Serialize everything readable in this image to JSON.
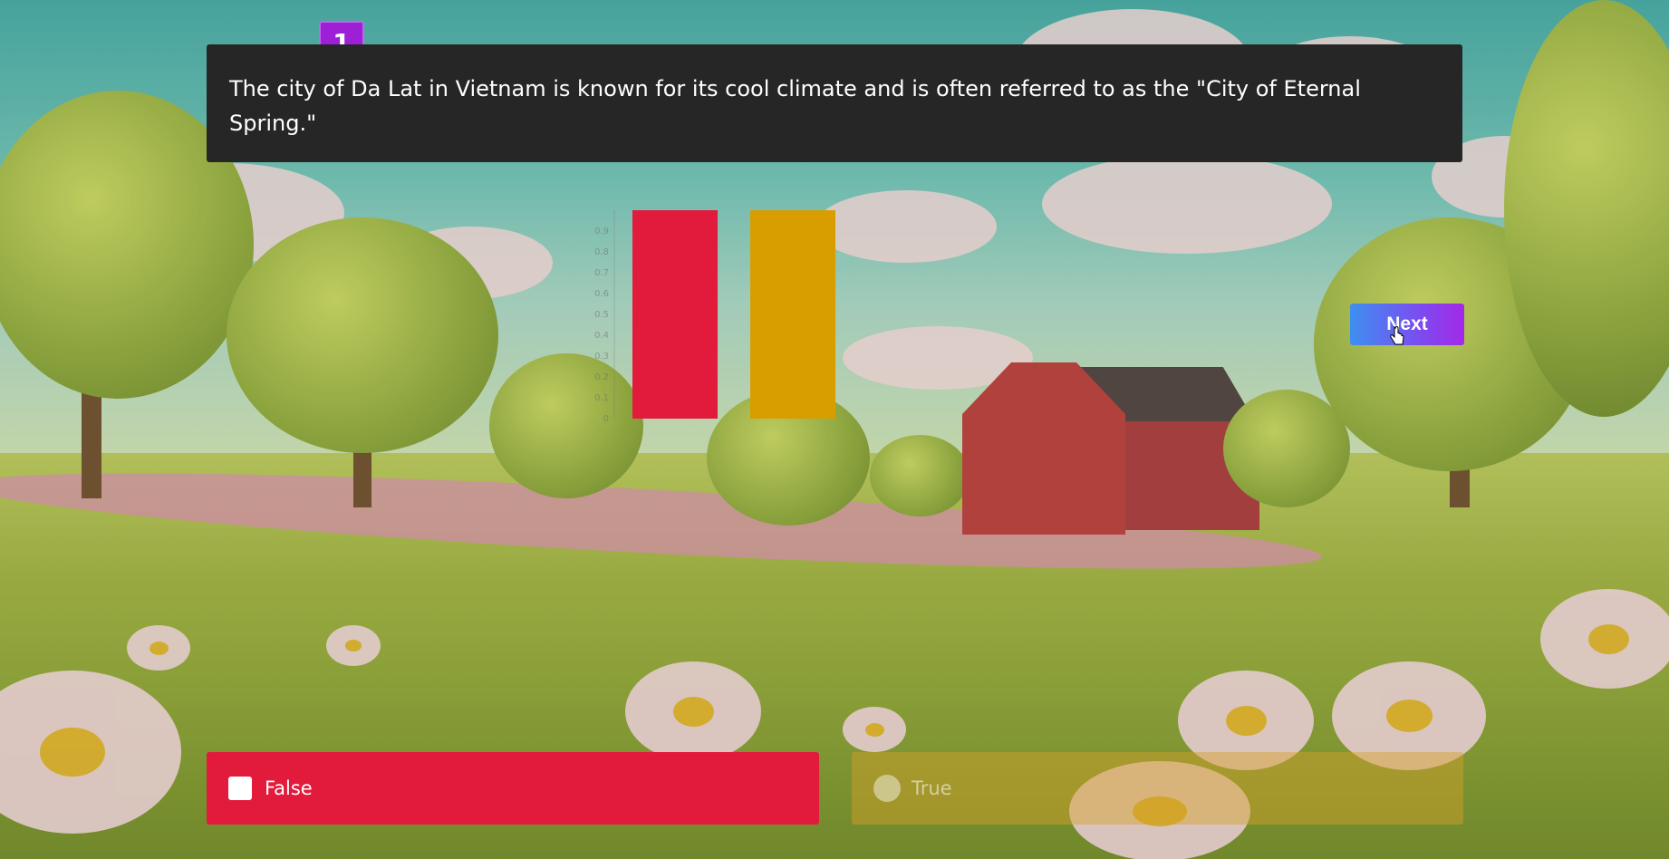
{
  "question": {
    "number": "1",
    "text": "The city of Da Lat in Vietnam is known for its cool climate and is often referred to as the \"City of Eternal Spring.\""
  },
  "chart_data": {
    "type": "bar",
    "categories": [
      "False",
      "True"
    ],
    "values": [
      1,
      1
    ],
    "ylim": [
      0,
      1
    ],
    "y_ticks": [
      "0",
      "0.1",
      "0.2",
      "0.3",
      "0.4",
      "0.5",
      "0.6",
      "0.7",
      "0.8",
      "0.9"
    ],
    "colors": [
      "#e21b3c",
      "#d89e00"
    ]
  },
  "next_button": {
    "label": "Next"
  },
  "answers": [
    {
      "label": "False",
      "icon": "square-icon",
      "color": "#e21b3c",
      "selected": true
    },
    {
      "label": "True",
      "icon": "circle-icon",
      "color": "#d89e00",
      "selected": false
    }
  ]
}
